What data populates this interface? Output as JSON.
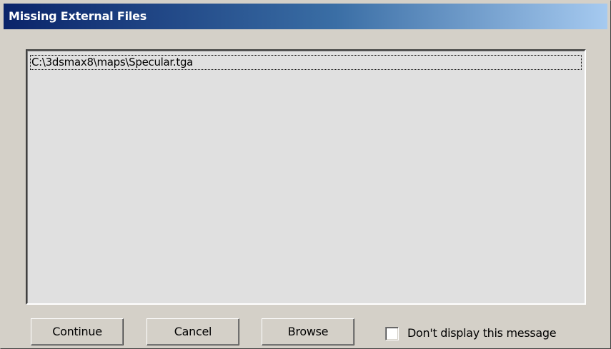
{
  "window": {
    "title": "Missing External Files"
  },
  "file_list": {
    "items": [
      "C:\\3dsmax8\\maps\\Specular.tga"
    ]
  },
  "buttons": {
    "continue_label": "Continue",
    "cancel_label": "Cancel",
    "browse_label": "Browse"
  },
  "dont_display": {
    "label": "Don't display this message",
    "checked": false
  },
  "colors": {
    "dialog_face": "#d4d0c8",
    "titlebar_start": "#0a246a",
    "titlebar_end": "#a6caf0",
    "listbox_background": "#e0e0e0"
  }
}
